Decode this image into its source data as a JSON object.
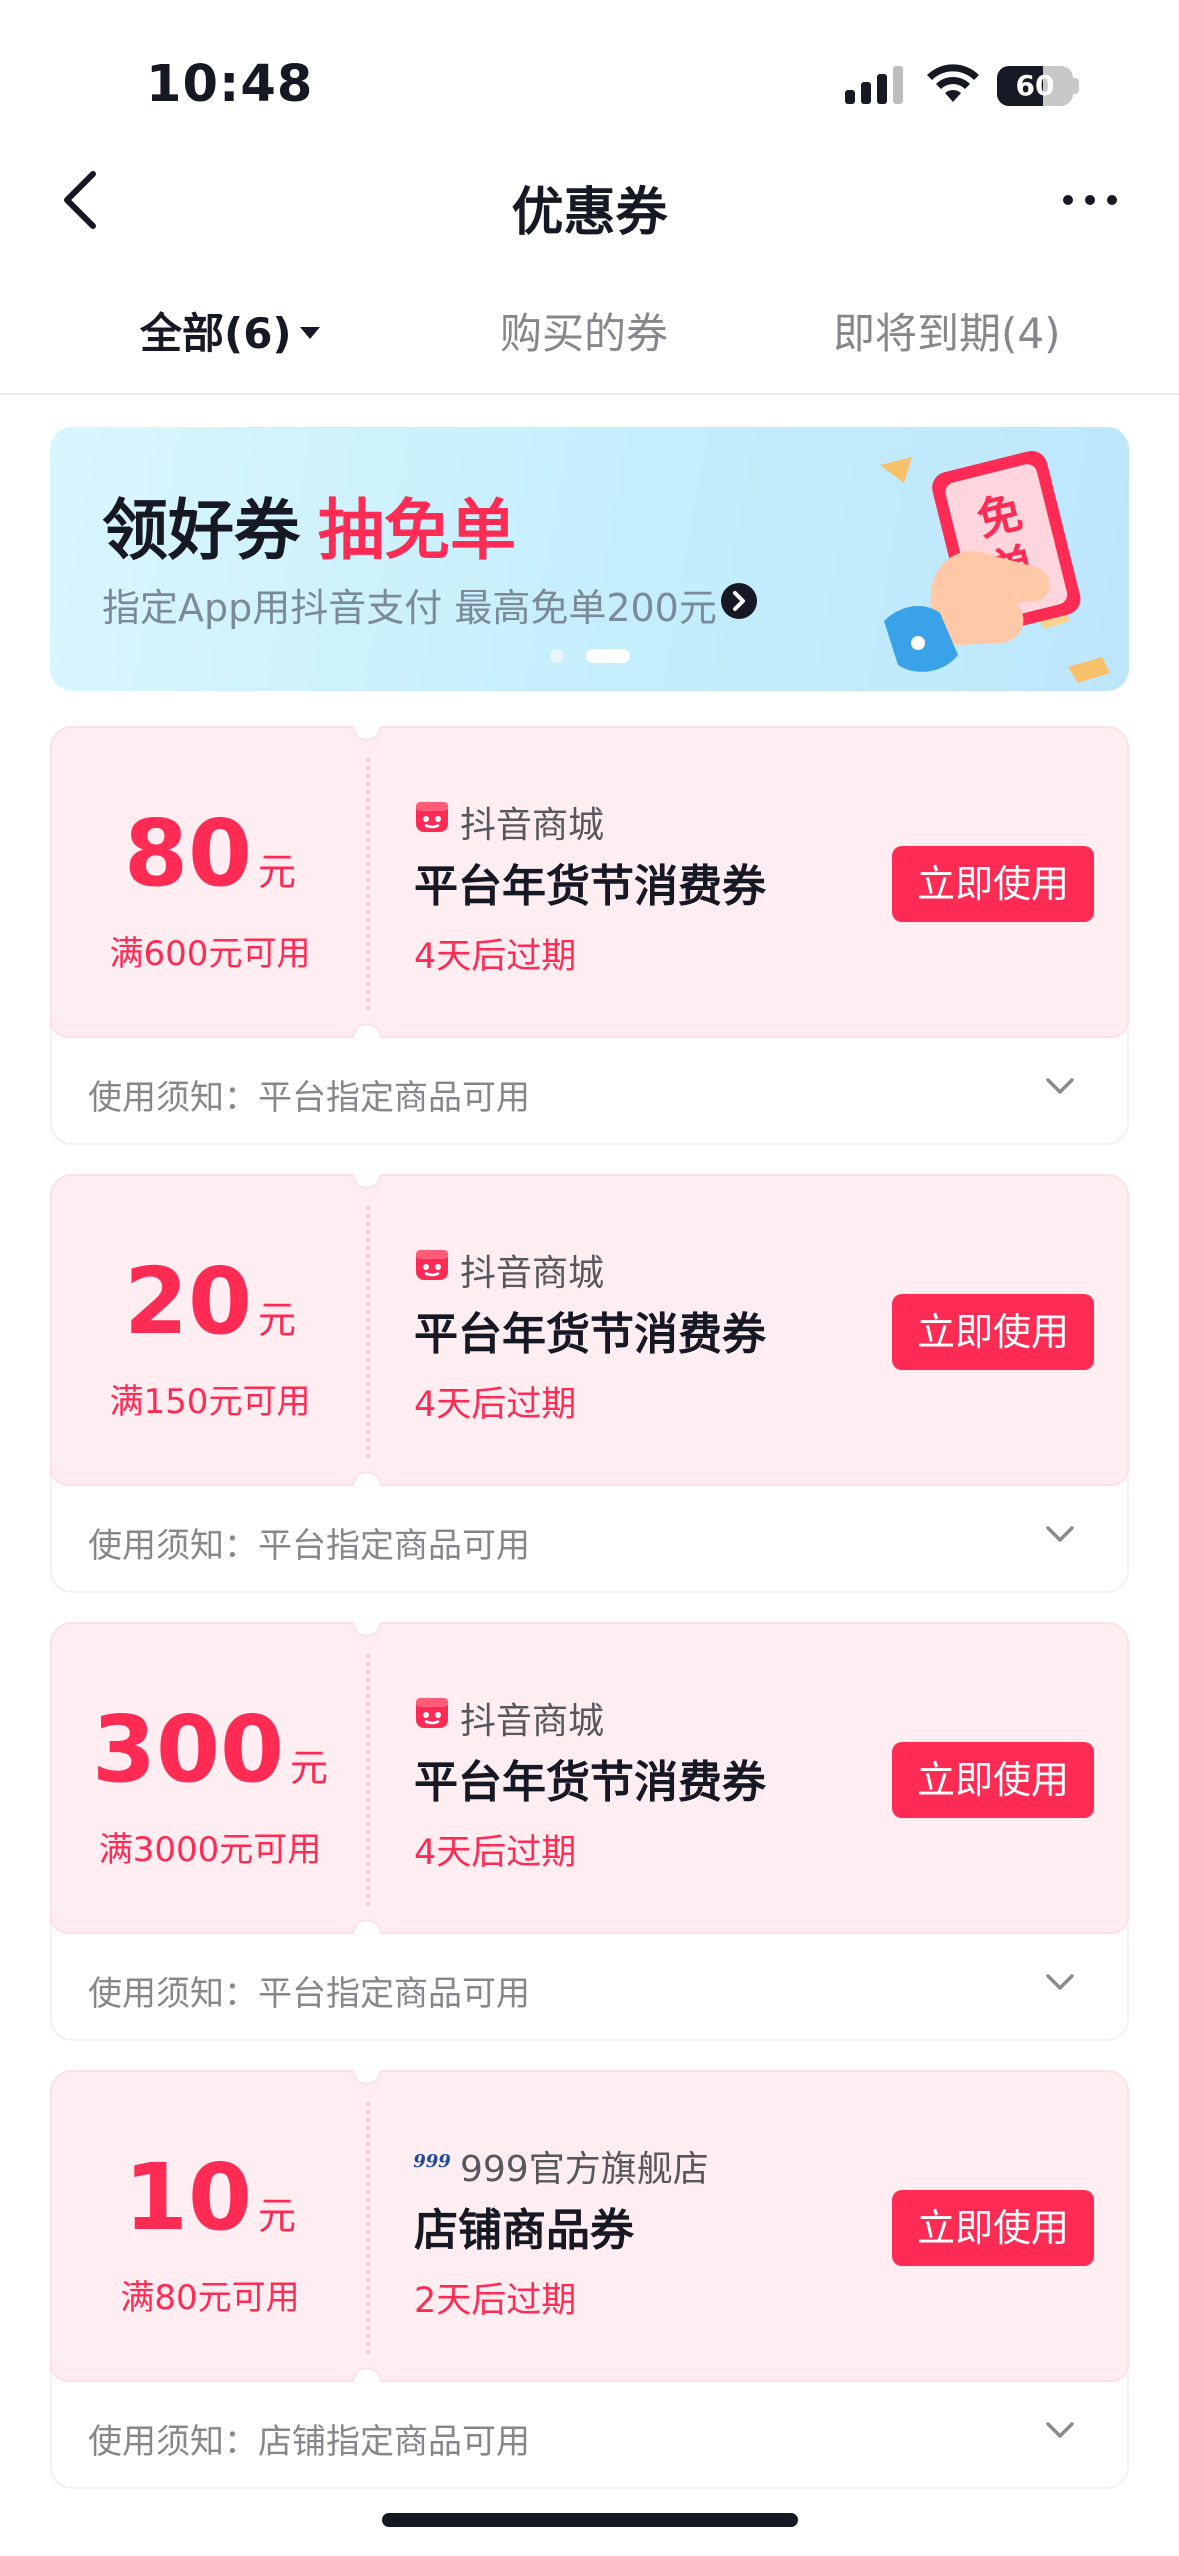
{
  "status": {
    "time": "10:48",
    "battery": "60",
    "battery_level": 0.6
  },
  "nav": {
    "title": "优惠券"
  },
  "tabs": [
    {
      "label": "全部(6)"
    },
    {
      "label": "购买的券"
    },
    {
      "label": "即将到期(4)"
    }
  ],
  "banner": {
    "title": "领好券",
    "highlight": "抽免单",
    "subtitle": "指定App用抖音支付 最高免单200元",
    "ticket_text": "免单",
    "active_slide": 2
  },
  "coupons": [
    {
      "amount": "80",
      "unit": "元",
      "condition": "满600元可用",
      "shop": "抖音商城",
      "shop_icon": "douyin-mall-icon",
      "name": "平台年货节消费券",
      "expire": "4天后过期",
      "button": "立即使用",
      "notice": "使用须知：平台指定商品可用"
    },
    {
      "amount": "20",
      "unit": "元",
      "condition": "满150元可用",
      "shop": "抖音商城",
      "shop_icon": "douyin-mall-icon",
      "name": "平台年货节消费券",
      "expire": "4天后过期",
      "button": "立即使用",
      "notice": "使用须知：平台指定商品可用"
    },
    {
      "amount": "300",
      "unit": "元",
      "condition": "满3000元可用",
      "shop": "抖音商城",
      "shop_icon": "douyin-mall-icon",
      "name": "平台年货节消费券",
      "expire": "4天后过期",
      "button": "立即使用",
      "notice": "使用须知：平台指定商品可用"
    },
    {
      "amount": "10",
      "unit": "元",
      "condition": "满80元可用",
      "shop": "999官方旗舰店",
      "shop_icon": "999-logo-icon",
      "shop_logo_text": "999",
      "name": "店铺商品券",
      "expire": "2天后过期",
      "button": "立即使用",
      "notice": "使用须知：店铺指定商品可用"
    }
  ],
  "colors": {
    "accent": "#fe2c55",
    "coupon_bg": "#ffeef1",
    "text": "#161823",
    "muted": "#86878c",
    "banner_bg": "#c4eefb"
  }
}
